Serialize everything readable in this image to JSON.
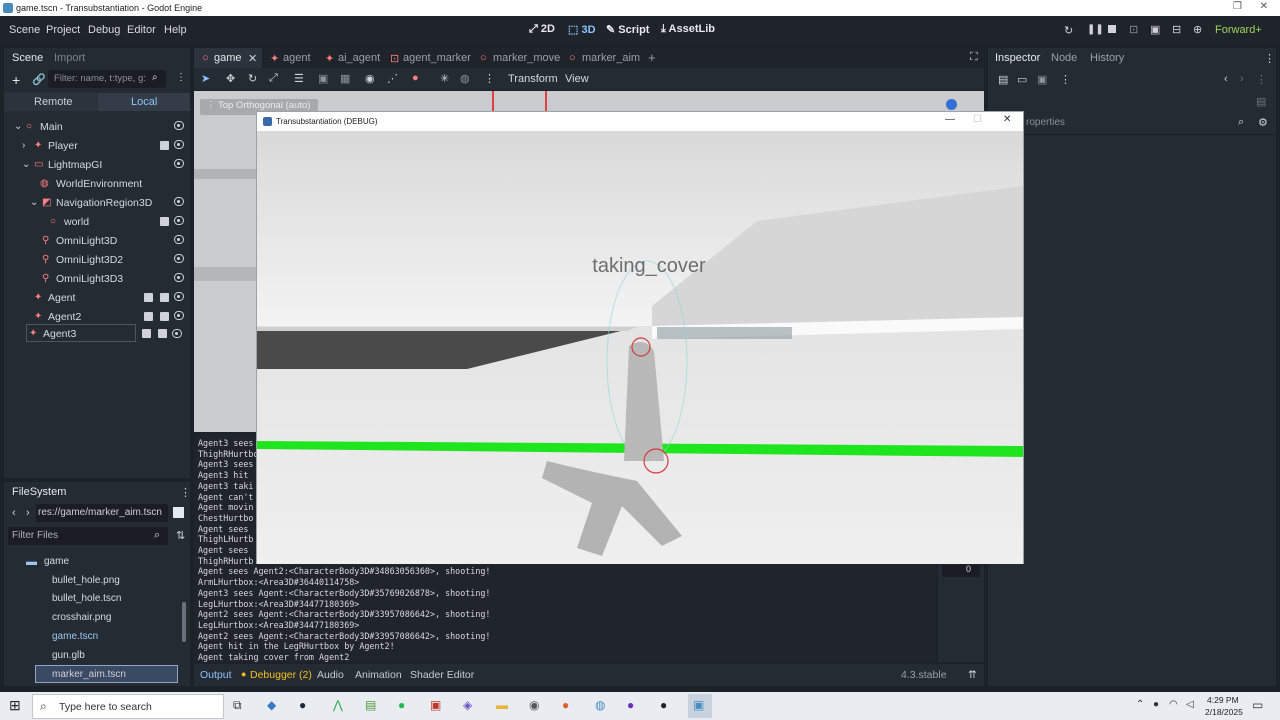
{
  "window": {
    "title": "game.tscn - Transubstantiation - Godot Engine"
  },
  "menu": [
    "Scene",
    "Project",
    "Debug",
    "Editor",
    "Help"
  ],
  "workspaces": [
    "2D",
    "3D",
    "Script",
    "AssetLib"
  ],
  "renderer": "Forward+",
  "scene_panel": {
    "tabs": [
      "Scene",
      "Import"
    ],
    "filter_placeholder": "Filter: name, t:type, g:",
    "remote": "Remote",
    "local": "Local",
    "nodes": [
      "Main",
      "Player",
      "LightmapGI",
      "WorldEnvironment",
      "NavigationRegion3D",
      "world",
      "OmniLight3D",
      "OmniLight3D2",
      "OmniLight3D3",
      "Agent",
      "Agent2",
      "Agent3"
    ]
  },
  "filesystem": {
    "title": "FileSystem",
    "path": "res://game/marker_aim.tscn",
    "filter_placeholder": "Filter Files",
    "items": [
      "game",
      "bullet_hole.png",
      "bullet_hole.tscn",
      "crosshair.png",
      "game.tscn",
      "gun.glb",
      "marker_aim.tscn"
    ]
  },
  "editor_tabs": [
    "game",
    "agent",
    "ai_agent",
    "agent_marker",
    "marker_move",
    "marker_aim"
  ],
  "viewport_toolbar": {
    "transform": "Transform",
    "view": "View",
    "viewport_label": "Top Orthogonal (auto)"
  },
  "inspector": {
    "tabs": [
      "Inspector",
      "Node",
      "History"
    ],
    "filter_fragment": "roperties"
  },
  "console_lines": [
    "Agent3 sees",
    "ThighRHurtbo",
    "Agent3 sees",
    "Agent3 hit",
    "Agent3 taki",
    "Agent can't",
    "Agent movin",
    "ChestHurtbo",
    "Agent sees",
    "ThighLHurtb",
    "Agent sees",
    "ThighRHurtb",
    "Agent sees Agent2:<CharacterBody3D#34863056360>, shooting!",
    "ArmLHurtbox:<Area3D#36440114758>",
    "Agent3 sees Agent:<CharacterBody3D#35769026878>, shooting!",
    "LegLHurtbox:<Area3D#34477180369>",
    "Agent2 sees Agent:<CharacterBody3D#33957086642>, shooting!",
    "LegLHurtbox:<Area3D#34477180369>",
    "Agent2 sees Agent:<CharacterBody3D#33957086642>, shooting!",
    "Agent hit in the LegRHurtbox by Agent2!",
    "Agent taking cover from Agent2"
  ],
  "bottom_tabs": [
    "Output",
    "Debugger (2)",
    "Audio",
    "Animation",
    "Shader Editor"
  ],
  "version": "4.3.stable",
  "game_window": {
    "title": "Transubstantiation (DEBUG)",
    "overlay_text": "taking_cover"
  },
  "taskbar": {
    "search": "Type here to search",
    "time": "4:29 PM",
    "date": "2/18/2025"
  },
  "side_number": "0"
}
